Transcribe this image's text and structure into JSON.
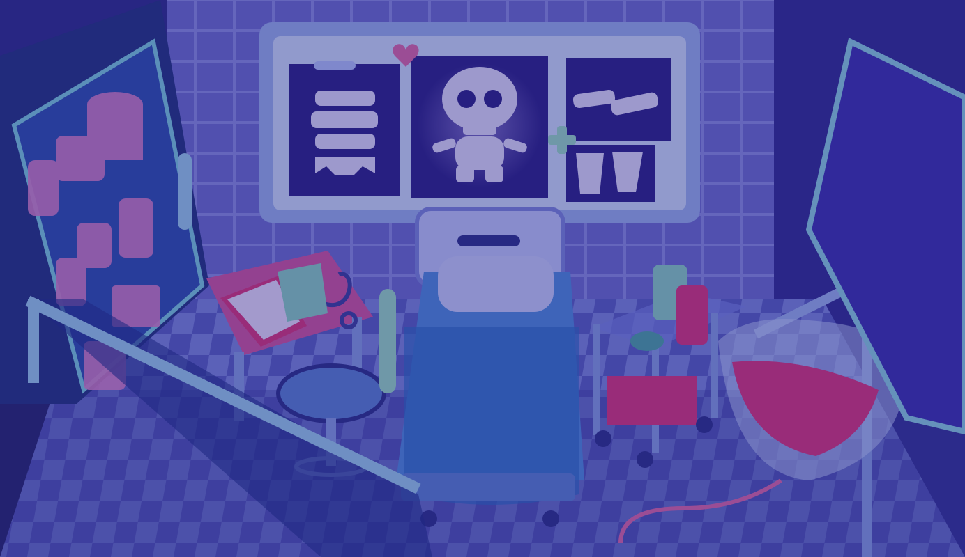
{
  "scene": {
    "name": "hospital-exam-room",
    "dimmed": true,
    "overlay_color": "#23207a",
    "palette": {
      "wall": "#6e6fd0",
      "wall_tile_line": "#8f92e6",
      "floor_light": "#7f8adf",
      "floor_dark": "#5a5fc4",
      "frame": "#9fb6f0",
      "xray_bg": "#2a1f86",
      "xray_bone": "#e9e4ff",
      "bed_sheet": "#4f8fe0",
      "pillow": "#cfd6ff",
      "blood": "#e2357a",
      "cabinet_glass": "#2d4fb0",
      "table_top": "#d8569f",
      "cart": "#7a87e8"
    },
    "icons": [
      "xray-skull-icon",
      "xray-ribs-icon",
      "xray-bones-icon",
      "stethoscope-icon",
      "clipboard-icon",
      "blood-bag-icon",
      "bone-emblem-icon",
      "bandage-cross-icon",
      "heart-pin-icon"
    ]
  }
}
